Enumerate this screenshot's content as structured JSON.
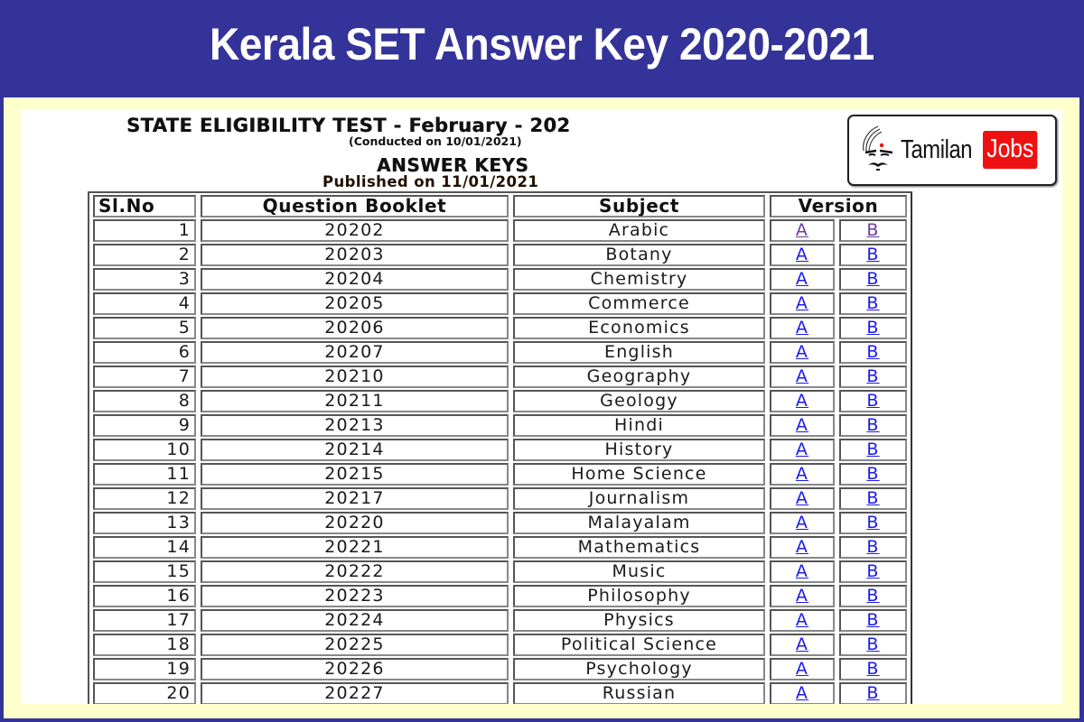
{
  "banner": {
    "title": "Kerala SET Answer Key 2020-2021"
  },
  "document": {
    "exam_title": "STATE ELIGIBILITY TEST - February - 202",
    "conducted": "(Conducted on 10/01/2021)",
    "section_title": "ANSWER KEYS",
    "published": "Published on 11/01/2021"
  },
  "logo": {
    "icon": "bharathiyar-face-icon",
    "text_main": "Tamilan",
    "text_badge": "Jobs",
    "badge_color": "#ee1111"
  },
  "colors": {
    "banner": "#333399",
    "frame": "#ffffcc",
    "link": "#1a1aee",
    "link_visited": "#6b3a9c"
  },
  "table": {
    "headers": {
      "sl_no": "Sl.No",
      "question_booklet": "Question Booklet",
      "subject": "Subject",
      "version": "Version"
    },
    "rows": [
      {
        "sl": "1",
        "booklet": "20202",
        "subject": "Arabic",
        "a": "A",
        "b": "B",
        "visited": true
      },
      {
        "sl": "2",
        "booklet": "20203",
        "subject": "Botany",
        "a": "A",
        "b": "B"
      },
      {
        "sl": "3",
        "booklet": "20204",
        "subject": "Chemistry",
        "a": "A",
        "b": "B"
      },
      {
        "sl": "4",
        "booklet": "20205",
        "subject": "Commerce",
        "a": "A",
        "b": "B"
      },
      {
        "sl": "5",
        "booklet": "20206",
        "subject": "Economics",
        "a": "A",
        "b": "B"
      },
      {
        "sl": "6",
        "booklet": "20207",
        "subject": "English",
        "a": "A",
        "b": "B"
      },
      {
        "sl": "7",
        "booklet": "20210",
        "subject": "Geography",
        "a": "A",
        "b": "B"
      },
      {
        "sl": "8",
        "booklet": "20211",
        "subject": "Geology",
        "a": "A",
        "b": "B"
      },
      {
        "sl": "9",
        "booklet": "20213",
        "subject": "Hindi",
        "a": "A",
        "b": "B"
      },
      {
        "sl": "10",
        "booklet": "20214",
        "subject": "History",
        "a": "A",
        "b": "B"
      },
      {
        "sl": "11",
        "booklet": "20215",
        "subject": "Home Science",
        "a": "A",
        "b": "B"
      },
      {
        "sl": "12",
        "booklet": "20217",
        "subject": "Journalism",
        "a": "A",
        "b": "B"
      },
      {
        "sl": "13",
        "booklet": "20220",
        "subject": "Malayalam",
        "a": "A",
        "b": "B"
      },
      {
        "sl": "14",
        "booklet": "20221",
        "subject": "Mathematics",
        "a": "A",
        "b": "B"
      },
      {
        "sl": "15",
        "booklet": "20222",
        "subject": "Music",
        "a": "A",
        "b": "B"
      },
      {
        "sl": "16",
        "booklet": "20223",
        "subject": "Philosophy",
        "a": "A",
        "b": "B"
      },
      {
        "sl": "17",
        "booklet": "20224",
        "subject": "Physics",
        "a": "A",
        "b": "B"
      },
      {
        "sl": "18",
        "booklet": "20225",
        "subject": "Political Science",
        "a": "A",
        "b": "B"
      },
      {
        "sl": "19",
        "booklet": "20226",
        "subject": "Psychology",
        "a": "A",
        "b": "B"
      },
      {
        "sl": "20",
        "booklet": "20227",
        "subject": "Russian",
        "a": "A",
        "b": "B"
      }
    ]
  }
}
